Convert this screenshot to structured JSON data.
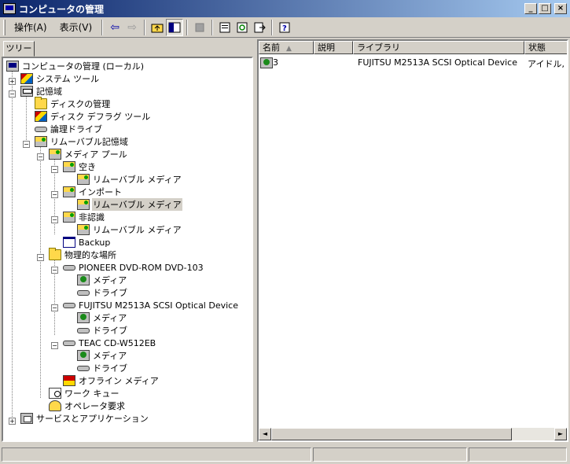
{
  "window": {
    "title": "コンピュータの管理",
    "buttons": {
      "minimize": "_",
      "maximize": "□",
      "close": "×"
    }
  },
  "toolbar": {
    "menu_action": "操作(A)",
    "menu_view": "表示(V)",
    "icons": [
      "back-arrow-icon",
      "forward-arrow-icon",
      "up-folder-icon",
      "show-tree-icon",
      "delete-icon",
      "properties-icon",
      "refresh-icon",
      "export-icon",
      "help-icon"
    ]
  },
  "tree": {
    "tab_label": "ツリー",
    "items": [
      {
        "label": "コンピュータの管理 (ローカル)",
        "icon": "computer-icon"
      },
      {
        "label": "システム ツール",
        "icon": "tools-icon"
      },
      {
        "label": "記憶域",
        "icon": "storage-icon"
      },
      {
        "label": "ディスクの管理",
        "icon": "folder-icon"
      },
      {
        "label": "ディスク デフラグ ツール",
        "icon": "defrag-icon"
      },
      {
        "label": "論理ドライブ",
        "icon": "drive-icon"
      },
      {
        "label": "リムーバブル記憶域",
        "icon": "removable-storage-icon"
      },
      {
        "label": "メディア プール",
        "icon": "media-pool-icon"
      },
      {
        "label": "空き",
        "icon": "media-pool-icon"
      },
      {
        "label": "リムーバブル メディア",
        "icon": "media-pool-icon"
      },
      {
        "label": "インポート",
        "icon": "media-pool-icon"
      },
      {
        "label": "リムーバブル メディア",
        "icon": "media-pool-icon"
      },
      {
        "label": "非認識",
        "icon": "media-pool-icon"
      },
      {
        "label": "リムーバブル メディア",
        "icon": "media-pool-icon"
      },
      {
        "label": "Backup",
        "icon": "window-icon"
      },
      {
        "label": "物理的な場所",
        "icon": "folder-icon"
      },
      {
        "label": "PIONEER DVD-ROM DVD-103",
        "icon": "drive-icon"
      },
      {
        "label": "メディア",
        "icon": "media-icon"
      },
      {
        "label": "ドライブ",
        "icon": "drive-icon"
      },
      {
        "label": "FUJITSU M2513A SCSI Optical Device",
        "icon": "drive-icon"
      },
      {
        "label": "メディア",
        "icon": "media-icon"
      },
      {
        "label": "ドライブ",
        "icon": "drive-icon"
      },
      {
        "label": "TEAC CD-W512EB",
        "icon": "drive-icon"
      },
      {
        "label": "メディア",
        "icon": "media-icon"
      },
      {
        "label": "ドライブ",
        "icon": "drive-icon"
      },
      {
        "label": "オフライン メディア",
        "icon": "offline-media-icon"
      },
      {
        "label": "ワーク キュー",
        "icon": "work-queue-icon"
      },
      {
        "label": "オペレータ要求",
        "icon": "operator-request-icon"
      },
      {
        "label": "サービスとアプリケーション",
        "icon": "services-icon"
      }
    ]
  },
  "list": {
    "columns": [
      "名前",
      "説明",
      "ライブラリ",
      "状態"
    ],
    "sort_indicator": "▲",
    "rows": [
      {
        "name": "3",
        "description": "",
        "library": "FUJITSU M2513A SCSI Optical Device",
        "status": "アイドル, 割"
      }
    ]
  },
  "scrollbar": {
    "left_arrow": "◄",
    "right_arrow": "►"
  }
}
